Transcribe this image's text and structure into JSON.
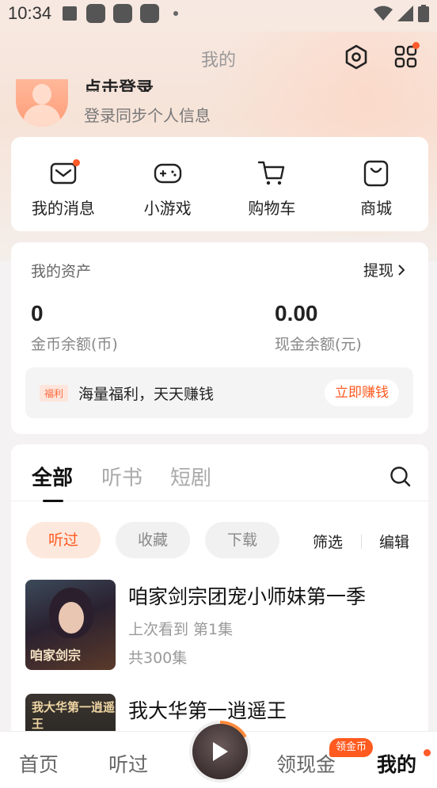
{
  "status": {
    "time": "10:34"
  },
  "header": {
    "title": "我的"
  },
  "user": {
    "login_title": "点击登录",
    "login_sub": "登录同步个人信息"
  },
  "quick_actions": [
    {
      "label": "我的消息",
      "icon": "message-icon"
    },
    {
      "label": "小游戏",
      "icon": "gamepad-icon"
    },
    {
      "label": "购物车",
      "icon": "cart-icon"
    },
    {
      "label": "商城",
      "icon": "shopping-bag-icon"
    }
  ],
  "assets": {
    "title": "我的资产",
    "withdraw": "提现",
    "coins_value": "0",
    "coins_label": "金币余额(币)",
    "cash_value": "0.00",
    "cash_label": "现金余额(元)",
    "benefit_tag": "福利",
    "benefit_text": "海量福利，天天赚钱",
    "earn_button": "立即赚钱"
  },
  "history": {
    "tabs": [
      "全部",
      "听书",
      "短剧"
    ],
    "chips": [
      "听过",
      "收藏",
      "下载"
    ],
    "filter": "筛选",
    "edit": "编辑",
    "items": [
      {
        "title": "咱家剑宗团宠小师妹第一季",
        "progress": "上次看到 第1集",
        "total": "共300集",
        "cover_text": "咱家剑宗"
      },
      {
        "title": "我大华第一逍遥王",
        "cover_text": "我大华第一逍遥王"
      }
    ]
  },
  "bottom_nav": {
    "items": [
      "首页",
      "听过",
      "领现金",
      "我的"
    ],
    "badge": "领金币"
  },
  "colors": {
    "accent": "#ff5a1f",
    "accent_light": "#fde8dd",
    "red_dot": "#ff5a2a"
  }
}
